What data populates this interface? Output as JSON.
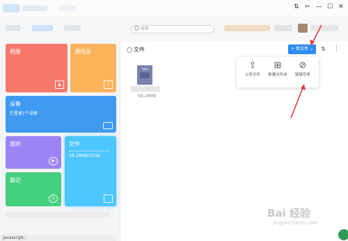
{
  "window_controls": {
    "pin": "⇅",
    "cut": "✂",
    "minimize": "—",
    "maximize": "☐",
    "close": "✕"
  },
  "header": {
    "search_placeholder": "搜索"
  },
  "tiles": {
    "album": {
      "title": "相册",
      "icon": "image-icon"
    },
    "contacts": {
      "title": "通讯录",
      "icon": "download-icon"
    },
    "devices": {
      "title": "设备",
      "subtitle": "已登录1个设备",
      "icon": "monitor-icon"
    },
    "wode": {
      "title": "我听",
      "icon": "play-icon"
    },
    "recent": {
      "title": "最近",
      "icon": "clock-icon"
    },
    "files": {
      "title": "文件",
      "subtitle": "58.28MB/35GB",
      "icon": "folder-icon",
      "usage_fraction": 0.0016
    }
  },
  "main": {
    "title": "文件",
    "new_button": "+ 新文件 ⌄",
    "file": {
      "ext": "exe",
      "size": "58.28MB"
    }
  },
  "dropdown": {
    "items": [
      {
        "label": "上传文件",
        "icon": "upload-icon"
      },
      {
        "label": "新建文件夹",
        "icon": "new-folder-icon"
      },
      {
        "label": "链接任务",
        "icon": "link-icon"
      }
    ]
  },
  "statusbar": {
    "text": "javascript:;"
  },
  "watermark": {
    "brand": "Bai 经验",
    "url": "jingyan.baidu.com"
  },
  "colors": {
    "album": "#f7786b",
    "contacts": "#fbb35b",
    "devices": "#3f9bef",
    "wode": "#9c84f5",
    "recent": "#45d07f",
    "files": "#4cc6fb",
    "accent": "#2f8cf2",
    "arrow": "#e23b3b"
  }
}
